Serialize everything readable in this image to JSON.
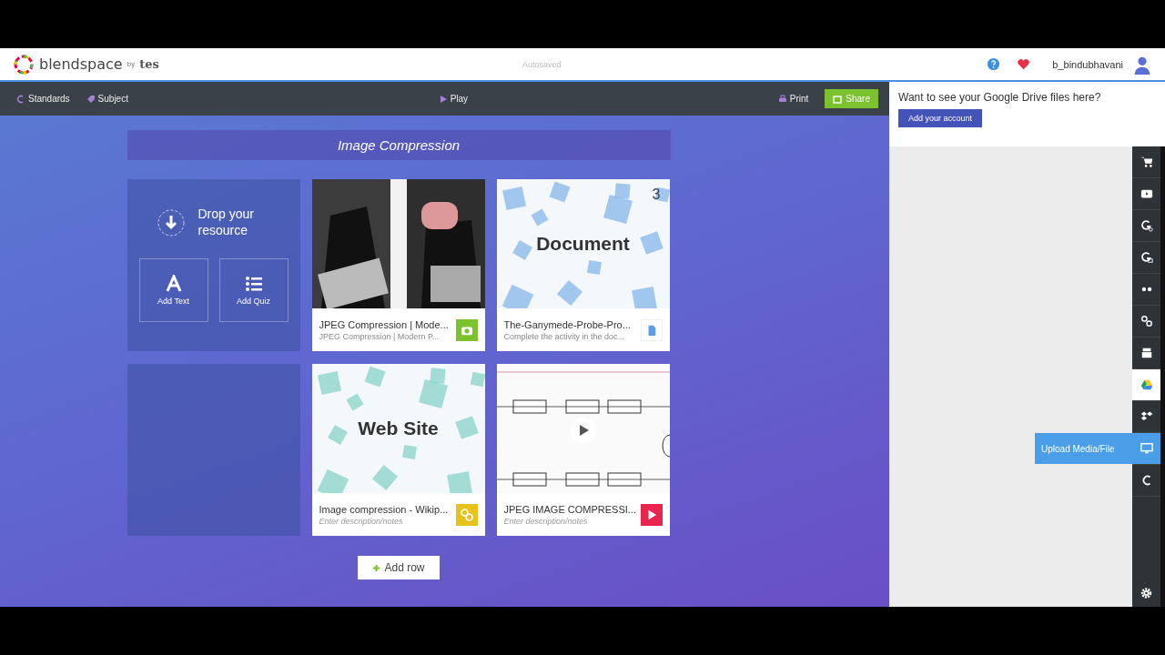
{
  "header": {
    "logo": "blendspace",
    "logo_by": "by",
    "logo_brand": "tes",
    "status": "Autosaved",
    "username": "b_bindubhavani"
  },
  "toolbar": {
    "items": [
      {
        "label": "Standards",
        "kind": "standards"
      },
      {
        "label": "Subject",
        "kind": "subject"
      }
    ],
    "play": "Play",
    "print": "Print",
    "share": "Share"
  },
  "lesson": {
    "title": "Image Compression",
    "drop": {
      "label": "Drop your resource",
      "actions": [
        {
          "label": "Add Text",
          "kind": "text"
        },
        {
          "label": "Add Quiz",
          "kind": "quiz"
        }
      ]
    },
    "tiles": [
      {
        "title": "JPEG Compression | Mode...",
        "description": "JPEG Compression | Modern P...",
        "placeholder": false
      },
      {
        "kind": "document",
        "thumb_label": "Document",
        "count": "3",
        "title": "The-Ganymede-Probe-Pro...",
        "description": "Complete the activity in the doc...",
        "placeholder": false
      },
      {
        "kind": "website",
        "thumb_label": "Web Site",
        "title": "Image compression - Wikip...",
        "description": "Enter description/notes",
        "placeholder": true
      },
      {
        "kind": "video",
        "title": "JPEG IMAGE COMPRESSI...",
        "description": "Enter description/notes",
        "placeholder": true
      }
    ],
    "add_row": "Add row"
  },
  "side_panel": {
    "prompt": "Want to see your Google Drive files here?",
    "button": "Add your account",
    "tools": [
      {
        "kind": "cart",
        "selected": false
      },
      {
        "kind": "video",
        "selected": false
      },
      {
        "kind": "google-link",
        "selected": false
      },
      {
        "kind": "google-image",
        "selected": false
      },
      {
        "kind": "dots",
        "selected": false
      },
      {
        "kind": "link",
        "selected": false
      },
      {
        "kind": "archive",
        "selected": false
      },
      {
        "kind": "drive",
        "selected": true
      },
      {
        "kind": "dropbox",
        "selected": false
      },
      {
        "kind": "monitor",
        "selected": false
      },
      {
        "kind": "c",
        "selected": false
      }
    ],
    "tooltip": "Upload Media/File"
  }
}
